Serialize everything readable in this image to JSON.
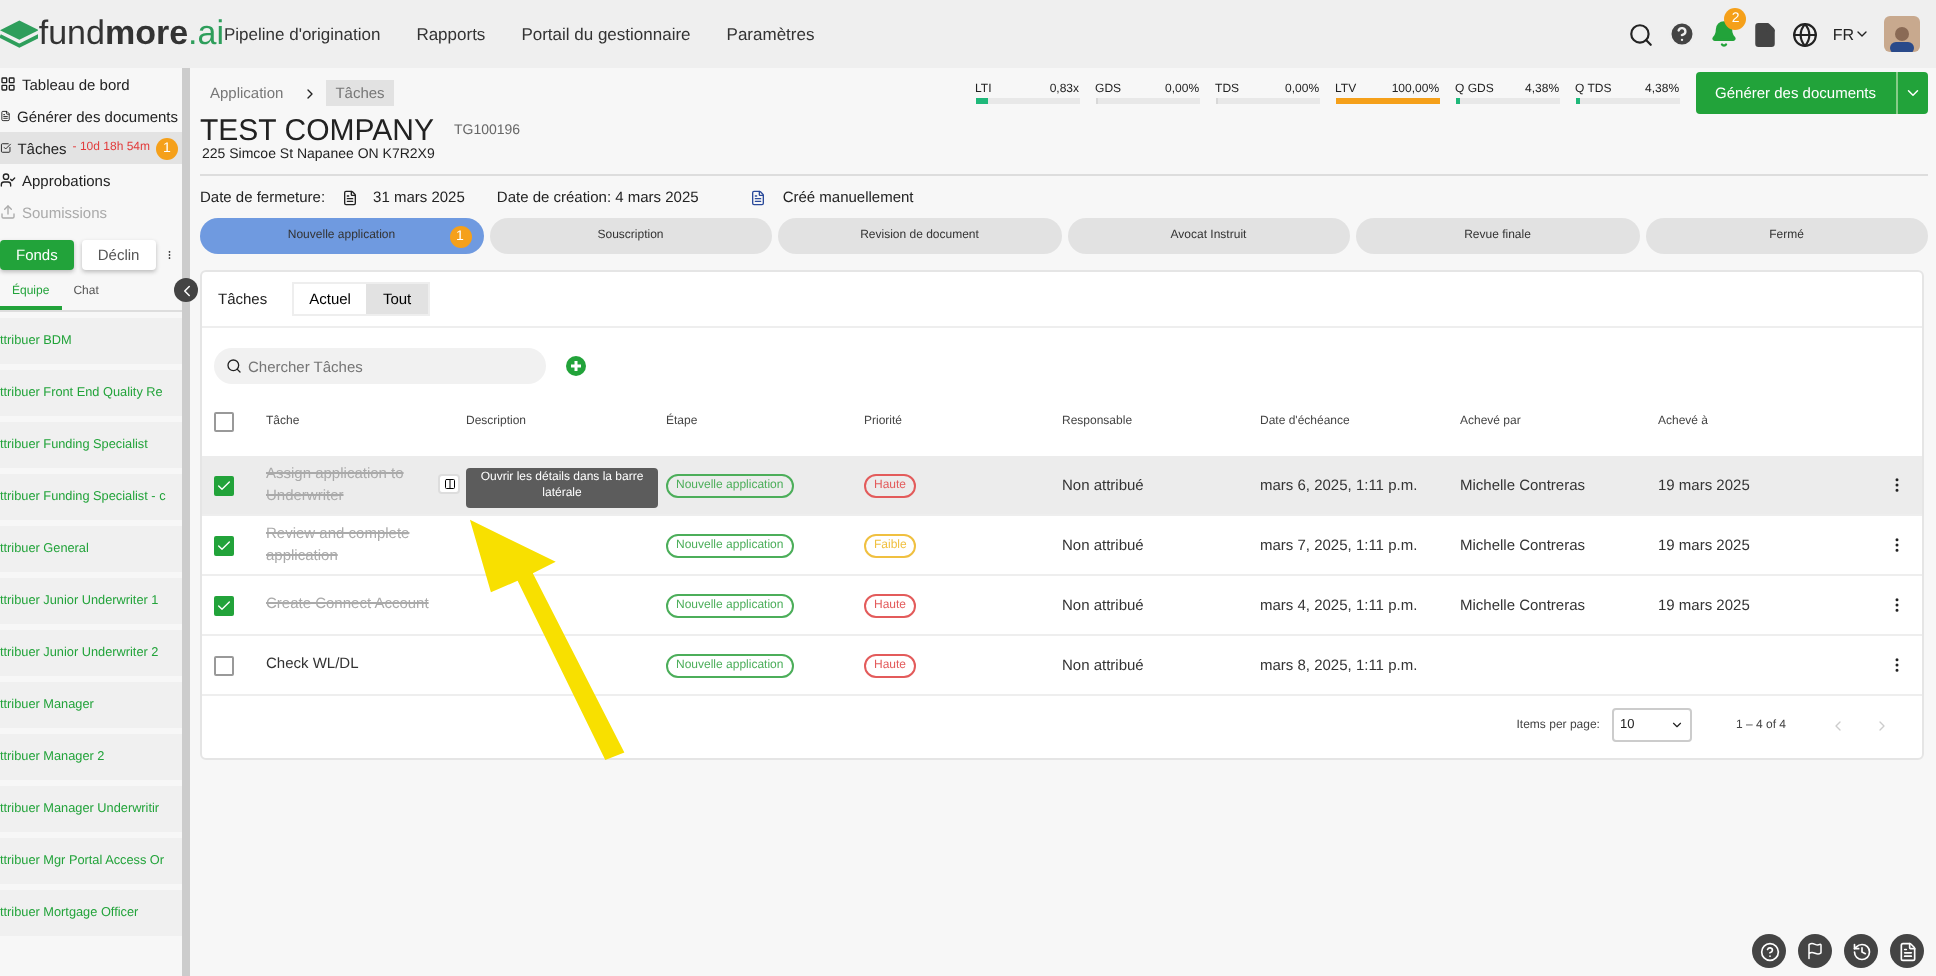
{
  "brand": {
    "name_plain": "fund",
    "name_bold": "more",
    "name_suffix": ".ai"
  },
  "nav": [
    "Pipeline d'origination",
    "Rapports",
    "Portail du gestionnaire",
    "Paramètres"
  ],
  "top_right": {
    "notifications": "2",
    "language": "FR"
  },
  "sidebar": {
    "items": [
      {
        "label": "Tableau de bord",
        "disabled": false,
        "selected": false
      },
      {
        "label": "Générer des documents",
        "disabled": false,
        "selected": false
      },
      {
        "label": "Tâches",
        "timer": "- 10d 18h 54m",
        "badge": "1",
        "disabled": false,
        "selected": true
      },
      {
        "label": "Approbations",
        "disabled": false,
        "selected": false
      },
      {
        "label": "Soumissions",
        "disabled": true,
        "selected": false
      }
    ],
    "toggle": [
      {
        "label": "Fonds",
        "selected": true
      },
      {
        "label": "Déclin",
        "selected": false
      }
    ],
    "tabs": [
      {
        "label": "Équipe",
        "selected": true
      },
      {
        "label": "Chat",
        "selected": false
      }
    ],
    "assign": [
      "ttribuer BDM",
      "ttribuer Front End Quality Re",
      "ttribuer Funding Specialist",
      "ttribuer Funding Specialist - c",
      "ttribuer General",
      "ttribuer Junior Underwriter 1",
      "ttribuer Junior Underwriter 2",
      "ttribuer Manager",
      "ttribuer Manager 2",
      "ttribuer Manager Underwritir",
      "ttribuer Mgr Portal Access Or",
      "ttribuer Mortgage Officer"
    ]
  },
  "breadcrumb": [
    "Application",
    "Tâches"
  ],
  "company": {
    "name": "TEST COMPANY",
    "id": "TG100196",
    "address": "225 Simcoe St Napanee ON K7R2X9"
  },
  "metrics": [
    {
      "label": "LTI",
      "value": "0,83x",
      "level": 0.12,
      "color": "#1fb87a"
    },
    {
      "label": "GDS",
      "value": "0,00%",
      "level": 0
    },
    {
      "label": "TDS",
      "value": "0,00%",
      "level": 0
    },
    {
      "label": "LTV",
      "value": "100,00%",
      "level": 1,
      "color": "#f5a01a"
    },
    {
      "label": "Q GDS",
      "value": "4,38%",
      "level": 0.04,
      "color": "#1fb87a"
    },
    {
      "label": "Q TDS",
      "value": "4,38%",
      "level": 0.04,
      "color": "#1fb87a"
    }
  ],
  "generate_button": "Générer des documents",
  "dates": {
    "closing_label": "Date de fermeture:",
    "closing": "31 mars 2025",
    "created": "Date de création: 4 mars 2025",
    "manual": "Créé manuellement"
  },
  "stages": [
    {
      "label": "Nouvelle application",
      "badge": "1",
      "selected": true
    },
    {
      "label": "Souscription",
      "selected": false
    },
    {
      "label": "Revision de document",
      "selected": false
    },
    {
      "label": "Avocat Instruit",
      "selected": false
    },
    {
      "label": "Revue finale",
      "selected": false
    },
    {
      "label": "Fermé",
      "selected": false
    }
  ],
  "tasks": {
    "title": "Tâches",
    "filters": [
      {
        "label": "Actuel",
        "selected": false
      },
      {
        "label": "Tout",
        "selected": true
      }
    ],
    "search": {
      "placeholder": "Chercher Tâches"
    },
    "select_all": {
      "checked": false
    },
    "columns": [
      "Tâche",
      "Description",
      "Étape",
      "Priorité",
      "Responsable",
      "Date d'échéance",
      "Achevé par",
      "Achevé à"
    ],
    "rows": [
      {
        "checked": true,
        "highlighted": true,
        "task": "Assign application to Underwriter",
        "tooltip": "Ouvrir les détails dans la barre latérale",
        "stage": "Nouvelle application",
        "priority": {
          "label": "Haute",
          "color": "#e35b5b"
        },
        "assignee": "Non attribué",
        "due": "mars 6, 2025, 1:11 p.m.",
        "done_by": "Michelle Contreras",
        "done_at": "19 mars 2025"
      },
      {
        "checked": true,
        "highlighted": false,
        "task": "Review and complete application",
        "stage": "Nouvelle application",
        "priority": {
          "label": "Faible",
          "color": "#f0c040"
        },
        "assignee": "Non attribué",
        "due": "mars 7, 2025, 1:11 p.m.",
        "done_by": "Michelle Contreras",
        "done_at": "19 mars 2025"
      },
      {
        "checked": true,
        "highlighted": false,
        "task": "Create Connect Account",
        "stage": "Nouvelle application",
        "priority": {
          "label": "Haute",
          "color": "#e35b5b"
        },
        "assignee": "Non attribué",
        "due": "mars 4, 2025, 1:11 p.m.",
        "done_by": "Michelle Contreras",
        "done_at": "19 mars 2025"
      },
      {
        "checked": false,
        "highlighted": false,
        "task": "Check WL/DL",
        "stage": "Nouvelle application",
        "priority": {
          "label": "Haute",
          "color": "#e35b5b"
        },
        "assignee": "Non attribué",
        "due": "mars 8, 2025, 1:11 p.m."
      }
    ],
    "paging": {
      "label": "Items per page:",
      "size": "10",
      "range": "1 – 4 of 4"
    }
  }
}
